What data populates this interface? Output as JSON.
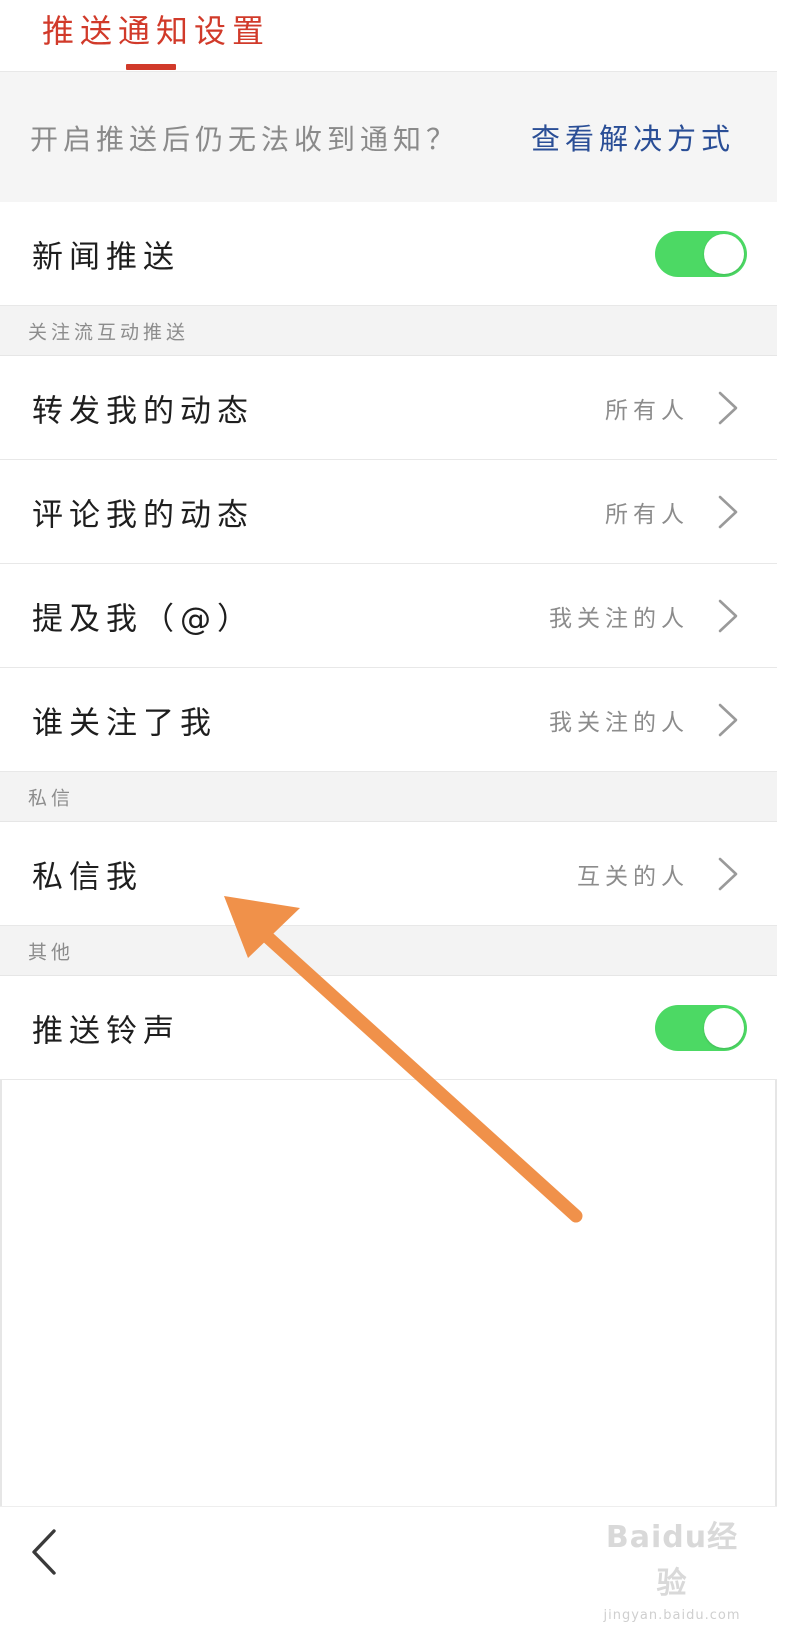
{
  "header": {
    "tab_label": "推送通知设置",
    "accent_color": "#d13a2a"
  },
  "notice": {
    "text": "开启推送后仍无法收到通知？",
    "link": "查看解决方式"
  },
  "settings": {
    "news_push": {
      "label": "新闻推送",
      "toggle_on": true
    },
    "section_follow": "关注流互动推送",
    "repost": {
      "label": "转发我的动态",
      "value": "所有人"
    },
    "comment": {
      "label": "评论我的动态",
      "value": "所有人"
    },
    "mention": {
      "label": "提及我（@）",
      "value": "我关注的人"
    },
    "follower": {
      "label": "谁关注了我",
      "value": "我关注的人"
    },
    "section_dm": "私信",
    "dm": {
      "label": "私信我",
      "value": "互关的人"
    },
    "section_other": "其他",
    "ringtone": {
      "label": "推送铃声",
      "toggle_on": true
    }
  },
  "bottom": {
    "back_icon": "chevron-left-icon",
    "watermark_logo": "Baidu经验",
    "watermark_url": "jingyan.baidu.com"
  },
  "colors": {
    "toggle_on": "#4cd964",
    "link": "#2a4e96",
    "annotation_arrow": "#f0914a"
  }
}
